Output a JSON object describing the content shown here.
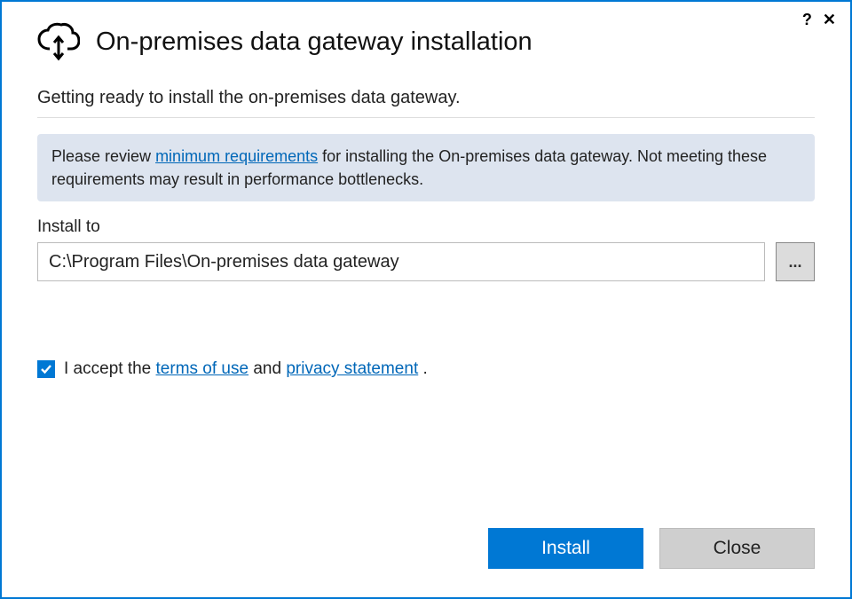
{
  "titlebar": {
    "help_symbol": "?",
    "close_symbol": "✕"
  },
  "header": {
    "title": "On-premises data gateway installation"
  },
  "body": {
    "subtitle": "Getting ready to install the on-premises data gateway.",
    "notice_prefix": "Please review ",
    "notice_link": "minimum requirements",
    "notice_suffix": " for installing the On-premises data gateway. Not meeting these requirements may result in performance bottlenecks.",
    "install_to_label": "Install to",
    "install_path": "C:\\Program Files\\On-premises data gateway",
    "browse_label": "...",
    "accept_prefix": "I accept the ",
    "terms_link": "terms of use",
    "accept_mid": " and ",
    "privacy_link": "privacy statement",
    "accept_suffix": " .",
    "accept_checked": true
  },
  "footer": {
    "install_label": "Install",
    "close_label": "Close"
  }
}
